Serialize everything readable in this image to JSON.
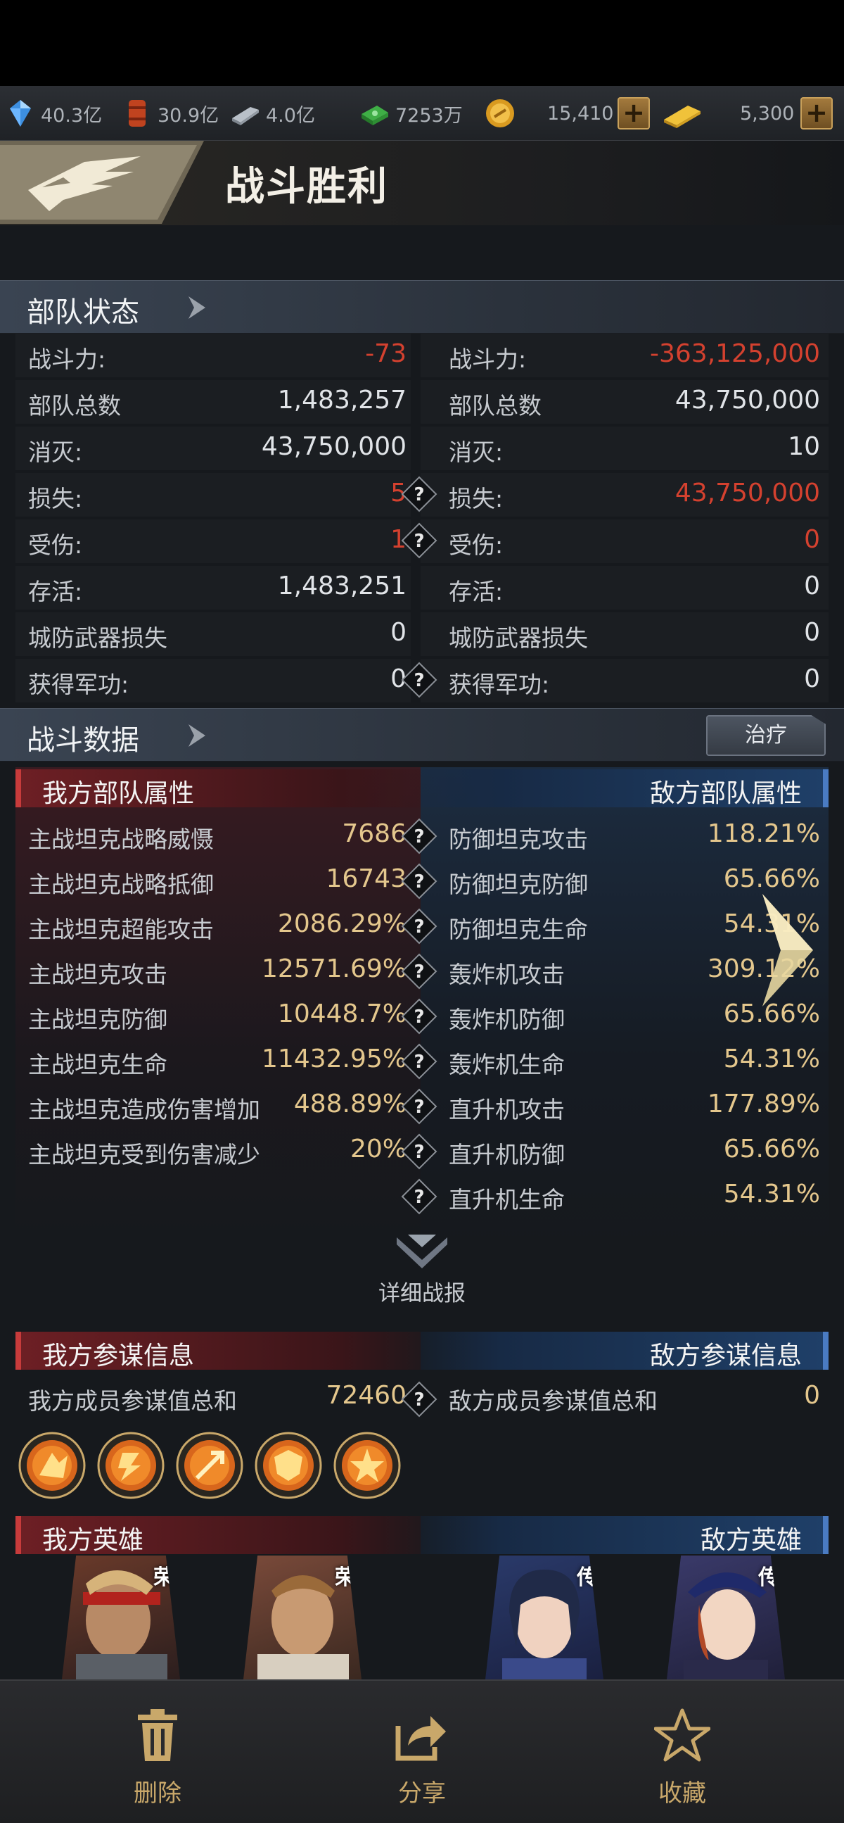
{
  "resources": [
    {
      "icon": "crystal-icon",
      "value": "40.3亿"
    },
    {
      "icon": "oil-barrel-icon",
      "value": "30.9亿"
    },
    {
      "icon": "steel-bar-icon",
      "value": "4.0亿"
    },
    {
      "icon": "cash-stack-icon",
      "value": "7253万"
    },
    {
      "icon": "gold-coin-icon",
      "value": "15,410"
    },
    {
      "icon": "gold-bar-icon",
      "value": "5,300"
    }
  ],
  "plus_label": "+",
  "header": {
    "title": "战斗胜利"
  },
  "troop_status": {
    "title": "部队状态",
    "rows": [
      {
        "left_label": "战斗力:",
        "left_value": "-73",
        "right_label": "战斗力:",
        "right_value": "-363,125,000"
      },
      {
        "left_label": "部队总数",
        "left_value": "1,483,257",
        "right_label": "部队总数",
        "right_value": "43,750,000"
      },
      {
        "left_label": "消灭:",
        "left_value": "43,750,000",
        "right_label": "消灭:",
        "right_value": "10"
      },
      {
        "left_label": "损失:",
        "left_value": "5",
        "right_label": "损失:",
        "right_value": "43,750,000"
      },
      {
        "left_label": "受伤:",
        "left_value": "1",
        "right_label": "受伤:",
        "right_value": "0"
      },
      {
        "left_label": "存活:",
        "left_value": "1,483,251",
        "right_label": "存活:",
        "right_value": "0"
      },
      {
        "left_label": "城防武器损失",
        "left_value": "0",
        "right_label": "城防武器损失",
        "right_value": "0"
      },
      {
        "left_label": "获得军功:",
        "left_value": "0",
        "right_label": "获得军功:",
        "right_value": "0"
      }
    ]
  },
  "battle_data": {
    "title": "战斗数据",
    "heal_label": "治疗",
    "my_attr_title": "我方部队属性",
    "enemy_attr_title": "敌方部队属性",
    "my_attrs": [
      {
        "label": "主战坦克战略威慑",
        "value": "7686"
      },
      {
        "label": "主战坦克战略抵御",
        "value": "16743"
      },
      {
        "label": "主战坦克超能攻击",
        "value": "2086.29%"
      },
      {
        "label": "主战坦克攻击",
        "value": "12571.69%"
      },
      {
        "label": "主战坦克防御",
        "value": "10448.7%"
      },
      {
        "label": "主战坦克生命",
        "value": "11432.95%"
      },
      {
        "label": "主战坦克造成伤害增加",
        "value": "488.89%"
      },
      {
        "label": "主战坦克受到伤害减少",
        "value": "20%"
      }
    ],
    "enemy_attrs": [
      {
        "label": "防御坦克攻击",
        "value": "118.21%"
      },
      {
        "label": "防御坦克防御",
        "value": "65.66%"
      },
      {
        "label": "防御坦克生命",
        "value": "54.31%"
      },
      {
        "label": "轰炸机攻击",
        "value": "309.12%"
      },
      {
        "label": "轰炸机防御",
        "value": "65.66%"
      },
      {
        "label": "轰炸机生命",
        "value": "54.31%"
      },
      {
        "label": "直升机攻击",
        "value": "177.89%"
      },
      {
        "label": "直升机防御",
        "value": "65.66%"
      },
      {
        "label": "直升机生命",
        "value": "54.31%"
      }
    ],
    "detail_label": "详细战报"
  },
  "counsellor": {
    "my_title": "我方参谋信息",
    "enemy_title": "敌方参谋信息",
    "my_label": "我方成员参谋值总和",
    "my_value": "72460",
    "enemy_label": "敌方成员参谋值总和",
    "enemy_value": "0",
    "icons": [
      "boots-skill-icon",
      "lightning-skill-icon",
      "sword-skill-icon",
      "shield-skill-icon",
      "burst-skill-icon"
    ]
  },
  "heroes": {
    "my_title": "我方英雄",
    "enemy_title": "敌方英雄",
    "my_badge": "荣",
    "enemy_badge": "传"
  },
  "bottom_nav": {
    "delete": "删除",
    "share": "分享",
    "favorite": "收藏"
  },
  "colors": {
    "red_value": "#d4412f",
    "gold_value": "#e4c78d",
    "accent_gold": "#c9a86a"
  }
}
